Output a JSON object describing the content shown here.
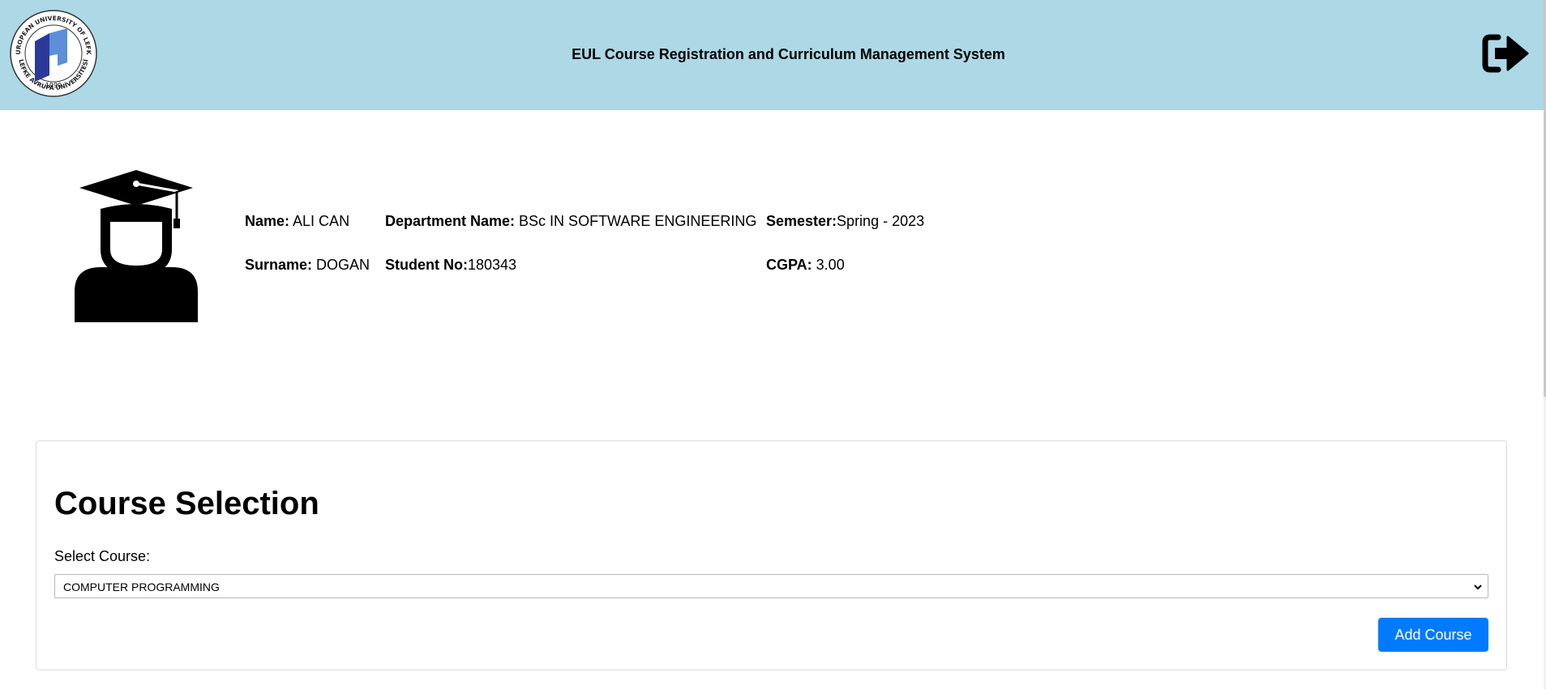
{
  "header": {
    "app_title": "EUL Course Registration and Curriculum Management System",
    "logo": {
      "ring_text": "EUROPEAN UNIVERSITY OF LEFKE · LEFKE AVRUPA ÜNİVERSİTESİ ·",
      "year": "1990"
    },
    "logout_icon": "sign-out-icon",
    "background_color": "#add8e6"
  },
  "student": {
    "avatar_icon": "graduate-student-icon",
    "name_label": "Name:",
    "name_value": " ALI CAN",
    "surname_label": "Surname:",
    "surname_value": " DOGAN",
    "department_label": "Department Name:",
    "department_value": " BSc IN SOFTWARE ENGINEERING",
    "student_no_label": "Student No:",
    "student_no_value": "180343",
    "semester_label": "Semester:",
    "semester_value": "Spring - 2023",
    "cgpa_label": "CGPA:",
    "cgpa_value": " 3.00"
  },
  "course_selection": {
    "title": "Course Selection",
    "select_label": "Select Course:",
    "selected_course": "COMPUTER PROGRAMMING",
    "add_button_label": "Add Course",
    "accent_color": "#007bff"
  }
}
